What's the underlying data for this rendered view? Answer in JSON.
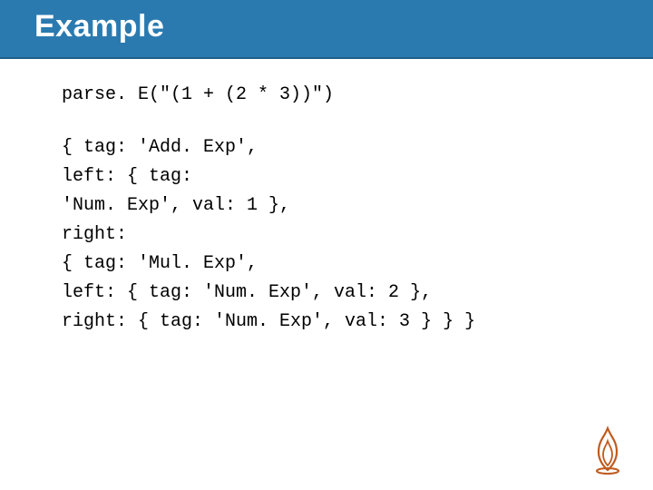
{
  "title": "Example",
  "code": {
    "line1": "parse. E(\"(1 + (2 * 3))\")",
    "l1": "{ tag: 'Add. Exp',",
    "l2": " left: { tag:",
    "l3": "'Num. Exp', val: 1 },",
    "l4": " right: ",
    "l5": "  { tag: 'Mul. Exp',",
    "l6": "   left: { tag: 'Num. Exp', val: 2 },",
    "l7": "   right: { tag: 'Num. Exp', val: 3 } } }"
  }
}
